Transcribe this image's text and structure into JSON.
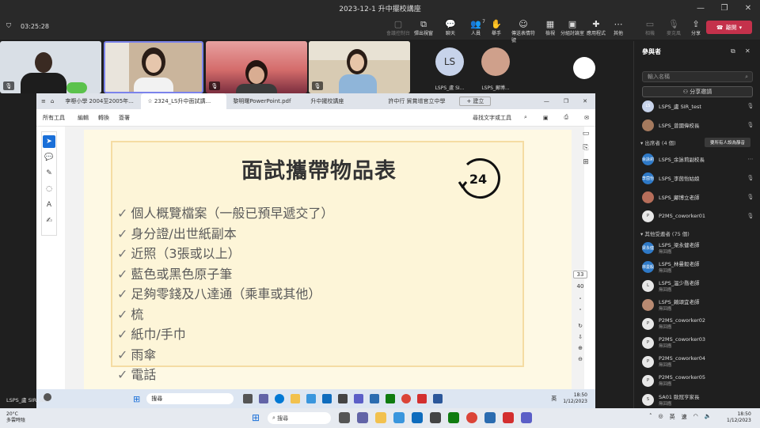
{
  "window": {
    "title": "2023-12-1 升中擺校講座"
  },
  "meeting": {
    "timer": "03:25:28",
    "toolbar": [
      {
        "label": "會議控制台",
        "icon": "camera-icon",
        "dim": true
      },
      {
        "label": "彈出視窗",
        "icon": "popout-icon",
        "dim": false
      },
      {
        "label": "聊天",
        "icon": "chat-icon",
        "dim": false
      },
      {
        "label": "人員",
        "icon": "people-icon",
        "dim": false,
        "badge": "7"
      },
      {
        "label": "舉手",
        "icon": "hand-icon",
        "dim": false
      },
      {
        "label": "傳送表情符號",
        "icon": "emoji-icon",
        "dim": false
      },
      {
        "label": "檢視",
        "icon": "view-icon",
        "dim": false
      },
      {
        "label": "分組討論室",
        "icon": "rooms-icon",
        "dim": false
      },
      {
        "label": "應用程式",
        "icon": "apps-icon",
        "dim": false
      },
      {
        "label": "其他",
        "icon": "more-icon",
        "dim": false
      },
      {
        "label": "相機",
        "icon": "video-icon",
        "dim": true
      },
      {
        "label": "麥克風",
        "icon": "mic-icon",
        "dim": true
      },
      {
        "label": "分享",
        "icon": "share-icon",
        "dim": false
      }
    ],
    "leave_label": "離開"
  },
  "video_tiles": [
    {
      "name": "",
      "muted": true
    },
    {
      "name": "",
      "muted": false
    },
    {
      "name": "",
      "muted": true
    },
    {
      "name": "",
      "muted": true
    }
  ],
  "avatar_tiles": [
    {
      "initials": "LS",
      "name": "LSPS_盧 SI...",
      "color": "#c7d3ea"
    },
    {
      "initials": "",
      "name": "LSPS_鄺博...",
      "color": "#cfa08b"
    }
  ],
  "browser": {
    "tabs": [
      "李嘢小學 2004至2005年...",
      "2324_LS升中面試講...",
      "黎明曙PowerPoint.pdf",
      "升中擺校講座",
      "許中行 貿賞增官立中學"
    ],
    "new_tab": "建立",
    "menu": [
      "所有工具",
      "編輯",
      "轉換",
      "簽署"
    ],
    "find_text": "尋找文字或工具",
    "page_current": "33",
    "page_next": "40"
  },
  "slide": {
    "title": "面試攜帶物品表",
    "clock_label": "24",
    "items": [
      "個人概覽檔案（一般已預早遞交了）",
      "身分證/出世紙副本",
      "近照（3張或以上）",
      "藍色或黑色原子筆",
      "足夠零錢及八達通（乘車或其他）",
      "梳",
      "紙巾/手巾",
      "雨傘",
      "電話"
    ]
  },
  "inner_taskbar": {
    "search": "搜尋",
    "time": "18:50",
    "date": "1/12/2023",
    "lang": "英"
  },
  "participants": {
    "title": "參與者",
    "search_placeholder": "輸入名稱",
    "invite_label": "分享邀請",
    "top": [
      {
        "name": "LSPS_盧 SIR_test",
        "sub": "",
        "color": "#c7d3ea",
        "initials": "LS"
      },
      {
        "name": "LSPS_曾國偉校長",
        "sub": "",
        "color": "#a57a5e",
        "initials": ""
      }
    ],
    "present_header": "出席者 (4 個)",
    "mute_all": "要所有人設為靜音",
    "present": [
      {
        "name": "LSPS_余詠莉副校長",
        "sub": "",
        "color": "#2e79c7",
        "initials": "余詠莉"
      },
      {
        "name": "LSPS_李茵怡姑娘",
        "sub": "",
        "color": "#2e79c7",
        "initials": "李茵怡"
      },
      {
        "name": "LSPS_鄺博立老師",
        "sub": "",
        "color": "#b76e5a",
        "initials": ""
      },
      {
        "name": "P2MS_coworker01",
        "sub": "",
        "color": "#e8e8e8",
        "initials": "P"
      }
    ],
    "others_header": "其他受邀者 (75 個)",
    "others": [
      {
        "name": "LSPS_梁永健老師",
        "sub": "無回應",
        "color": "#2e79c7",
        "initials": "梁永健"
      },
      {
        "name": "LSPS_林曼毅老師",
        "sub": "無回應",
        "color": "#2e79c7",
        "initials": "林曼毅"
      },
      {
        "name": "LSPS_溫少喬老師",
        "sub": "無回應",
        "color": "#e8e8e8",
        "initials": "L"
      },
      {
        "name": "LSPS_賴頌宜老師",
        "sub": "無回應",
        "color": "#b88a72",
        "initials": ""
      },
      {
        "name": "P2MS_coworker02",
        "sub": "無回應",
        "color": "#e8e8e8",
        "initials": "P"
      },
      {
        "name": "P2MS_coworker03",
        "sub": "無回應",
        "color": "#e8e8e8",
        "initials": "P"
      },
      {
        "name": "P2MS_coworker04",
        "sub": "無回應",
        "color": "#e8e8e8",
        "initials": "P"
      },
      {
        "name": "P2MS_coworker05",
        "sub": "無回應",
        "color": "#e8e8e8",
        "initials": "P"
      },
      {
        "name": "SA01 歐冠亨家長",
        "sub": "無回應",
        "color": "#e8e8e8",
        "initials": "S"
      }
    ]
  },
  "self_name": "LSPS_盧 SIR_test",
  "taskbar": {
    "weather_temp": "20°C",
    "weather_desc": "多雲時陰",
    "search": "搜尋",
    "lang1": "英",
    "lang2": "速",
    "time": "18:50",
    "date": "1/12/2023"
  }
}
